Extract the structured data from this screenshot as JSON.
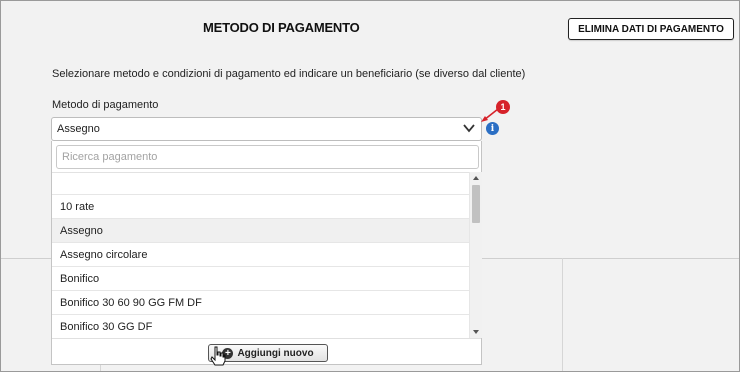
{
  "header": {
    "title": "METODO DI PAGAMENTO",
    "delete_button": "ELIMINA DATI DI PAGAMENTO"
  },
  "instructions": "Selezionare metodo e condizioni di pagamento ed indicare un beneficiario (se diverso dal cliente)",
  "field": {
    "label": "Metodo di pagamento",
    "selected_value": "Assegno"
  },
  "annotation": {
    "badge_number": "1",
    "info_icon": "i",
    "badge_color": "#d6222a",
    "info_color": "#2b6fc4"
  },
  "dropdown": {
    "search_placeholder": "Ricerca pagamento",
    "items": [
      {
        "label": ""
      },
      {
        "label": "10 rate"
      },
      {
        "label": "Assegno"
      },
      {
        "label": "Assegno circolare"
      },
      {
        "label": "Bonifico"
      },
      {
        "label": "Bonifico 30 60 90 GG FM DF"
      },
      {
        "label": "Bonifico 30 GG DF"
      }
    ],
    "add_button": "Aggiungi nuovo"
  }
}
